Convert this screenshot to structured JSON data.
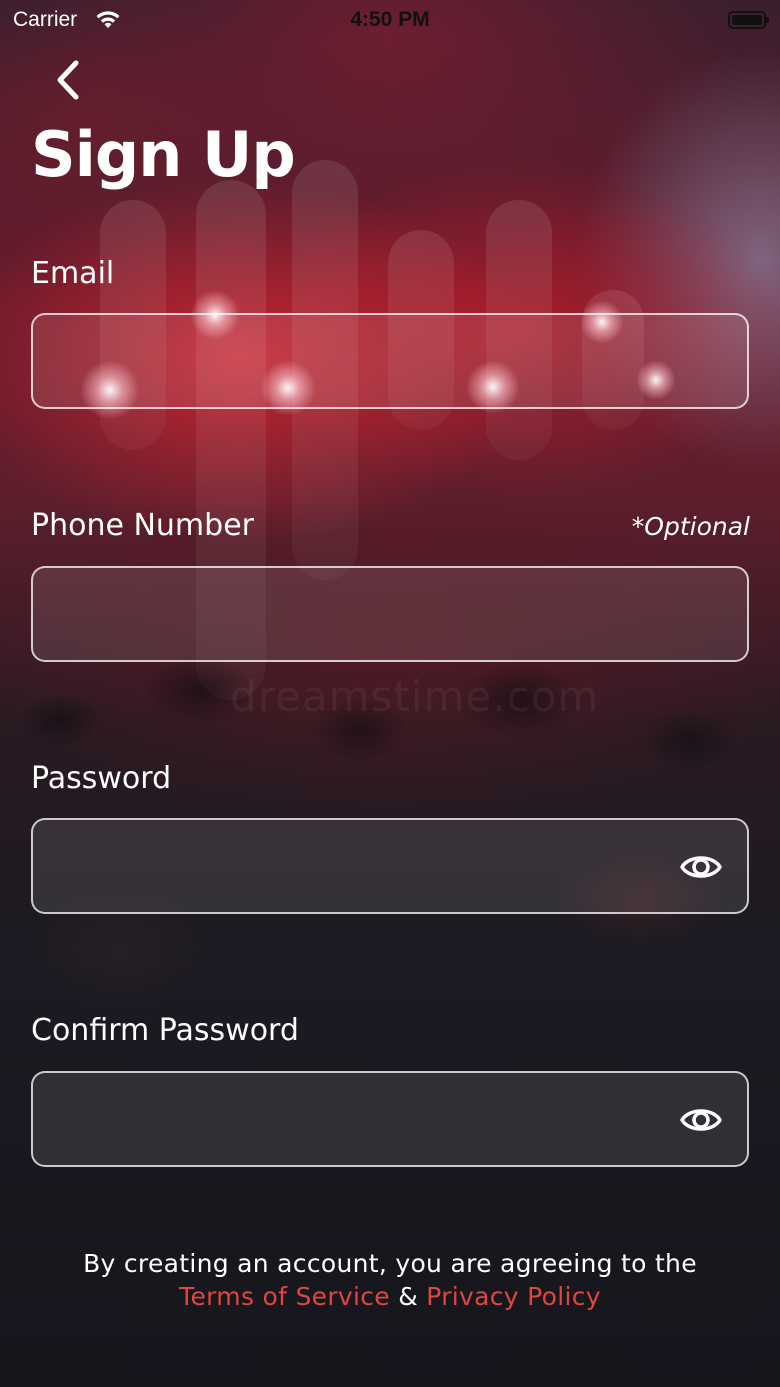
{
  "status_bar": {
    "carrier": "Carrier",
    "time": "4:50 PM"
  },
  "header": {
    "back_icon": "chevron-left-icon",
    "title": "Sign Up"
  },
  "form": {
    "email": {
      "label": "Email",
      "value": ""
    },
    "phone": {
      "label": "Phone Number",
      "optional": "*Optional",
      "value": ""
    },
    "password": {
      "label": "Password",
      "value": "",
      "icon": "eye-icon"
    },
    "confirm_password": {
      "label": "Confirm Password",
      "value": "",
      "icon": "eye-icon"
    }
  },
  "legal": {
    "text": "By creating an account, you are agreeing to the",
    "terms_link": "Terms of Service",
    "separator": "&",
    "privacy_link": "Privacy Policy"
  },
  "background_watermark": "dreamstime.com",
  "colors": {
    "link": "#e0453f",
    "field_border": "#ffffff",
    "text": "#ffffff"
  }
}
